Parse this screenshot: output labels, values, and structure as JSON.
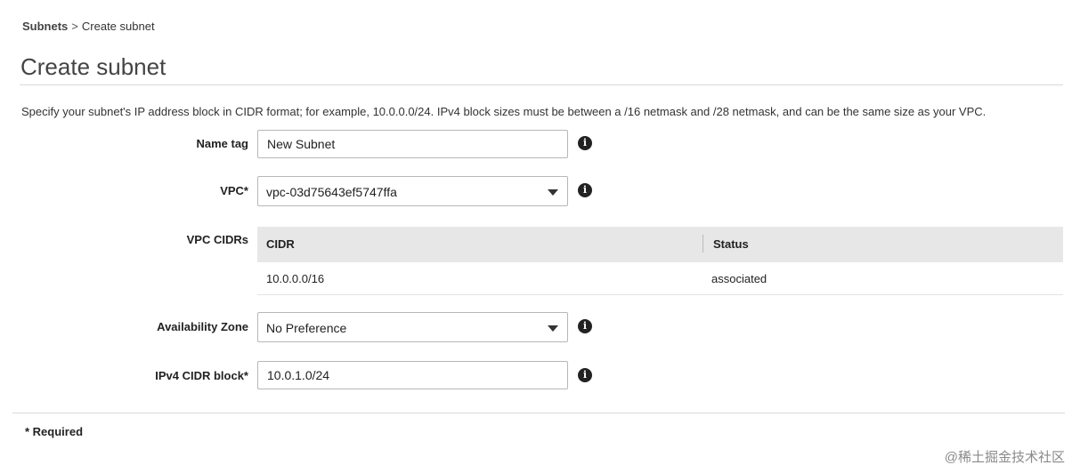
{
  "breadcrumb": {
    "parent": "Subnets",
    "separator": ">",
    "current": "Create subnet"
  },
  "page_title": "Create subnet",
  "description": "Specify your subnet's IP address block in CIDR format; for example, 10.0.0.0/24. IPv4 block sizes must be between a /16 netmask and /28 netmask, and can be the same size as your VPC.",
  "form": {
    "name_tag": {
      "label": "Name tag",
      "value": "New Subnet"
    },
    "vpc": {
      "label": "VPC*",
      "selected": "vpc-03d75643ef5747ffa"
    },
    "vpc_cidrs": {
      "label": "VPC CIDRs",
      "columns": [
        "CIDR",
        "Status"
      ],
      "rows": [
        {
          "cidr": "10.0.0.0/16",
          "status": "associated"
        }
      ]
    },
    "availability_zone": {
      "label": "Availability Zone",
      "selected": "No Preference"
    },
    "ipv4_cidr": {
      "label": "IPv4 CIDR block*",
      "value": "10.0.1.0/24"
    }
  },
  "info_icon_glyph": "i",
  "required_note": "* Required",
  "watermark": "@稀土掘金技术社区",
  "icons": {
    "info": "info-circle-icon",
    "dropdown": "caret-down-icon"
  }
}
